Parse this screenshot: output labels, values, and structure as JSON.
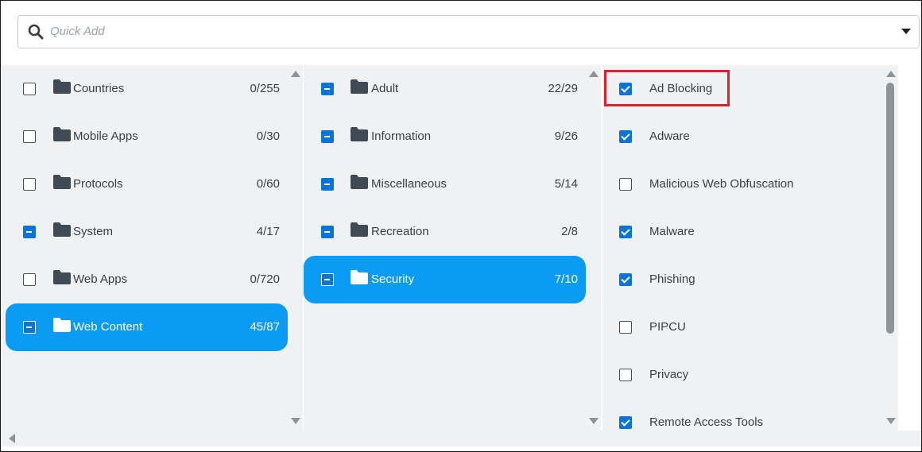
{
  "search": {
    "placeholder": "Quick Add"
  },
  "columns": {
    "categories": [
      {
        "label": "Countries",
        "count": "0/255",
        "state": "unchecked",
        "selected": false
      },
      {
        "label": "Mobile Apps",
        "count": "0/30",
        "state": "unchecked",
        "selected": false
      },
      {
        "label": "Protocols",
        "count": "0/60",
        "state": "unchecked",
        "selected": false
      },
      {
        "label": "System",
        "count": "4/17",
        "state": "partial",
        "selected": false
      },
      {
        "label": "Web Apps",
        "count": "0/720",
        "state": "unchecked",
        "selected": false
      },
      {
        "label": "Web Content",
        "count": "45/87",
        "state": "partial",
        "selected": true
      }
    ],
    "subcategories": [
      {
        "label": "Adult",
        "count": "22/29",
        "state": "partial",
        "selected": false
      },
      {
        "label": "Information",
        "count": "9/26",
        "state": "partial",
        "selected": false
      },
      {
        "label": "Miscellaneous",
        "count": "5/14",
        "state": "partial",
        "selected": false
      },
      {
        "label": "Recreation",
        "count": "2/8",
        "state": "partial",
        "selected": false
      },
      {
        "label": "Security",
        "count": "7/10",
        "state": "partial",
        "selected": true
      }
    ],
    "items": [
      {
        "label": "Ad Blocking",
        "state": "checked"
      },
      {
        "label": "Adware",
        "state": "checked"
      },
      {
        "label": "Malicious Web Obfuscation",
        "state": "unchecked"
      },
      {
        "label": "Malware",
        "state": "checked"
      },
      {
        "label": "Phishing",
        "state": "checked"
      },
      {
        "label": "PIPCU",
        "state": "unchecked"
      },
      {
        "label": "Privacy",
        "state": "unchecked"
      },
      {
        "label": "Remote Access Tools",
        "state": "checked"
      }
    ]
  },
  "colors": {
    "selected": "#0a9bf5",
    "checkbox": "#0b74d8",
    "highlight": "#e0202a",
    "folder": "#3f4a54"
  },
  "icons": {
    "search": "search-icon",
    "folder": "folder-icon",
    "dropdown": "chevron-down-icon"
  }
}
